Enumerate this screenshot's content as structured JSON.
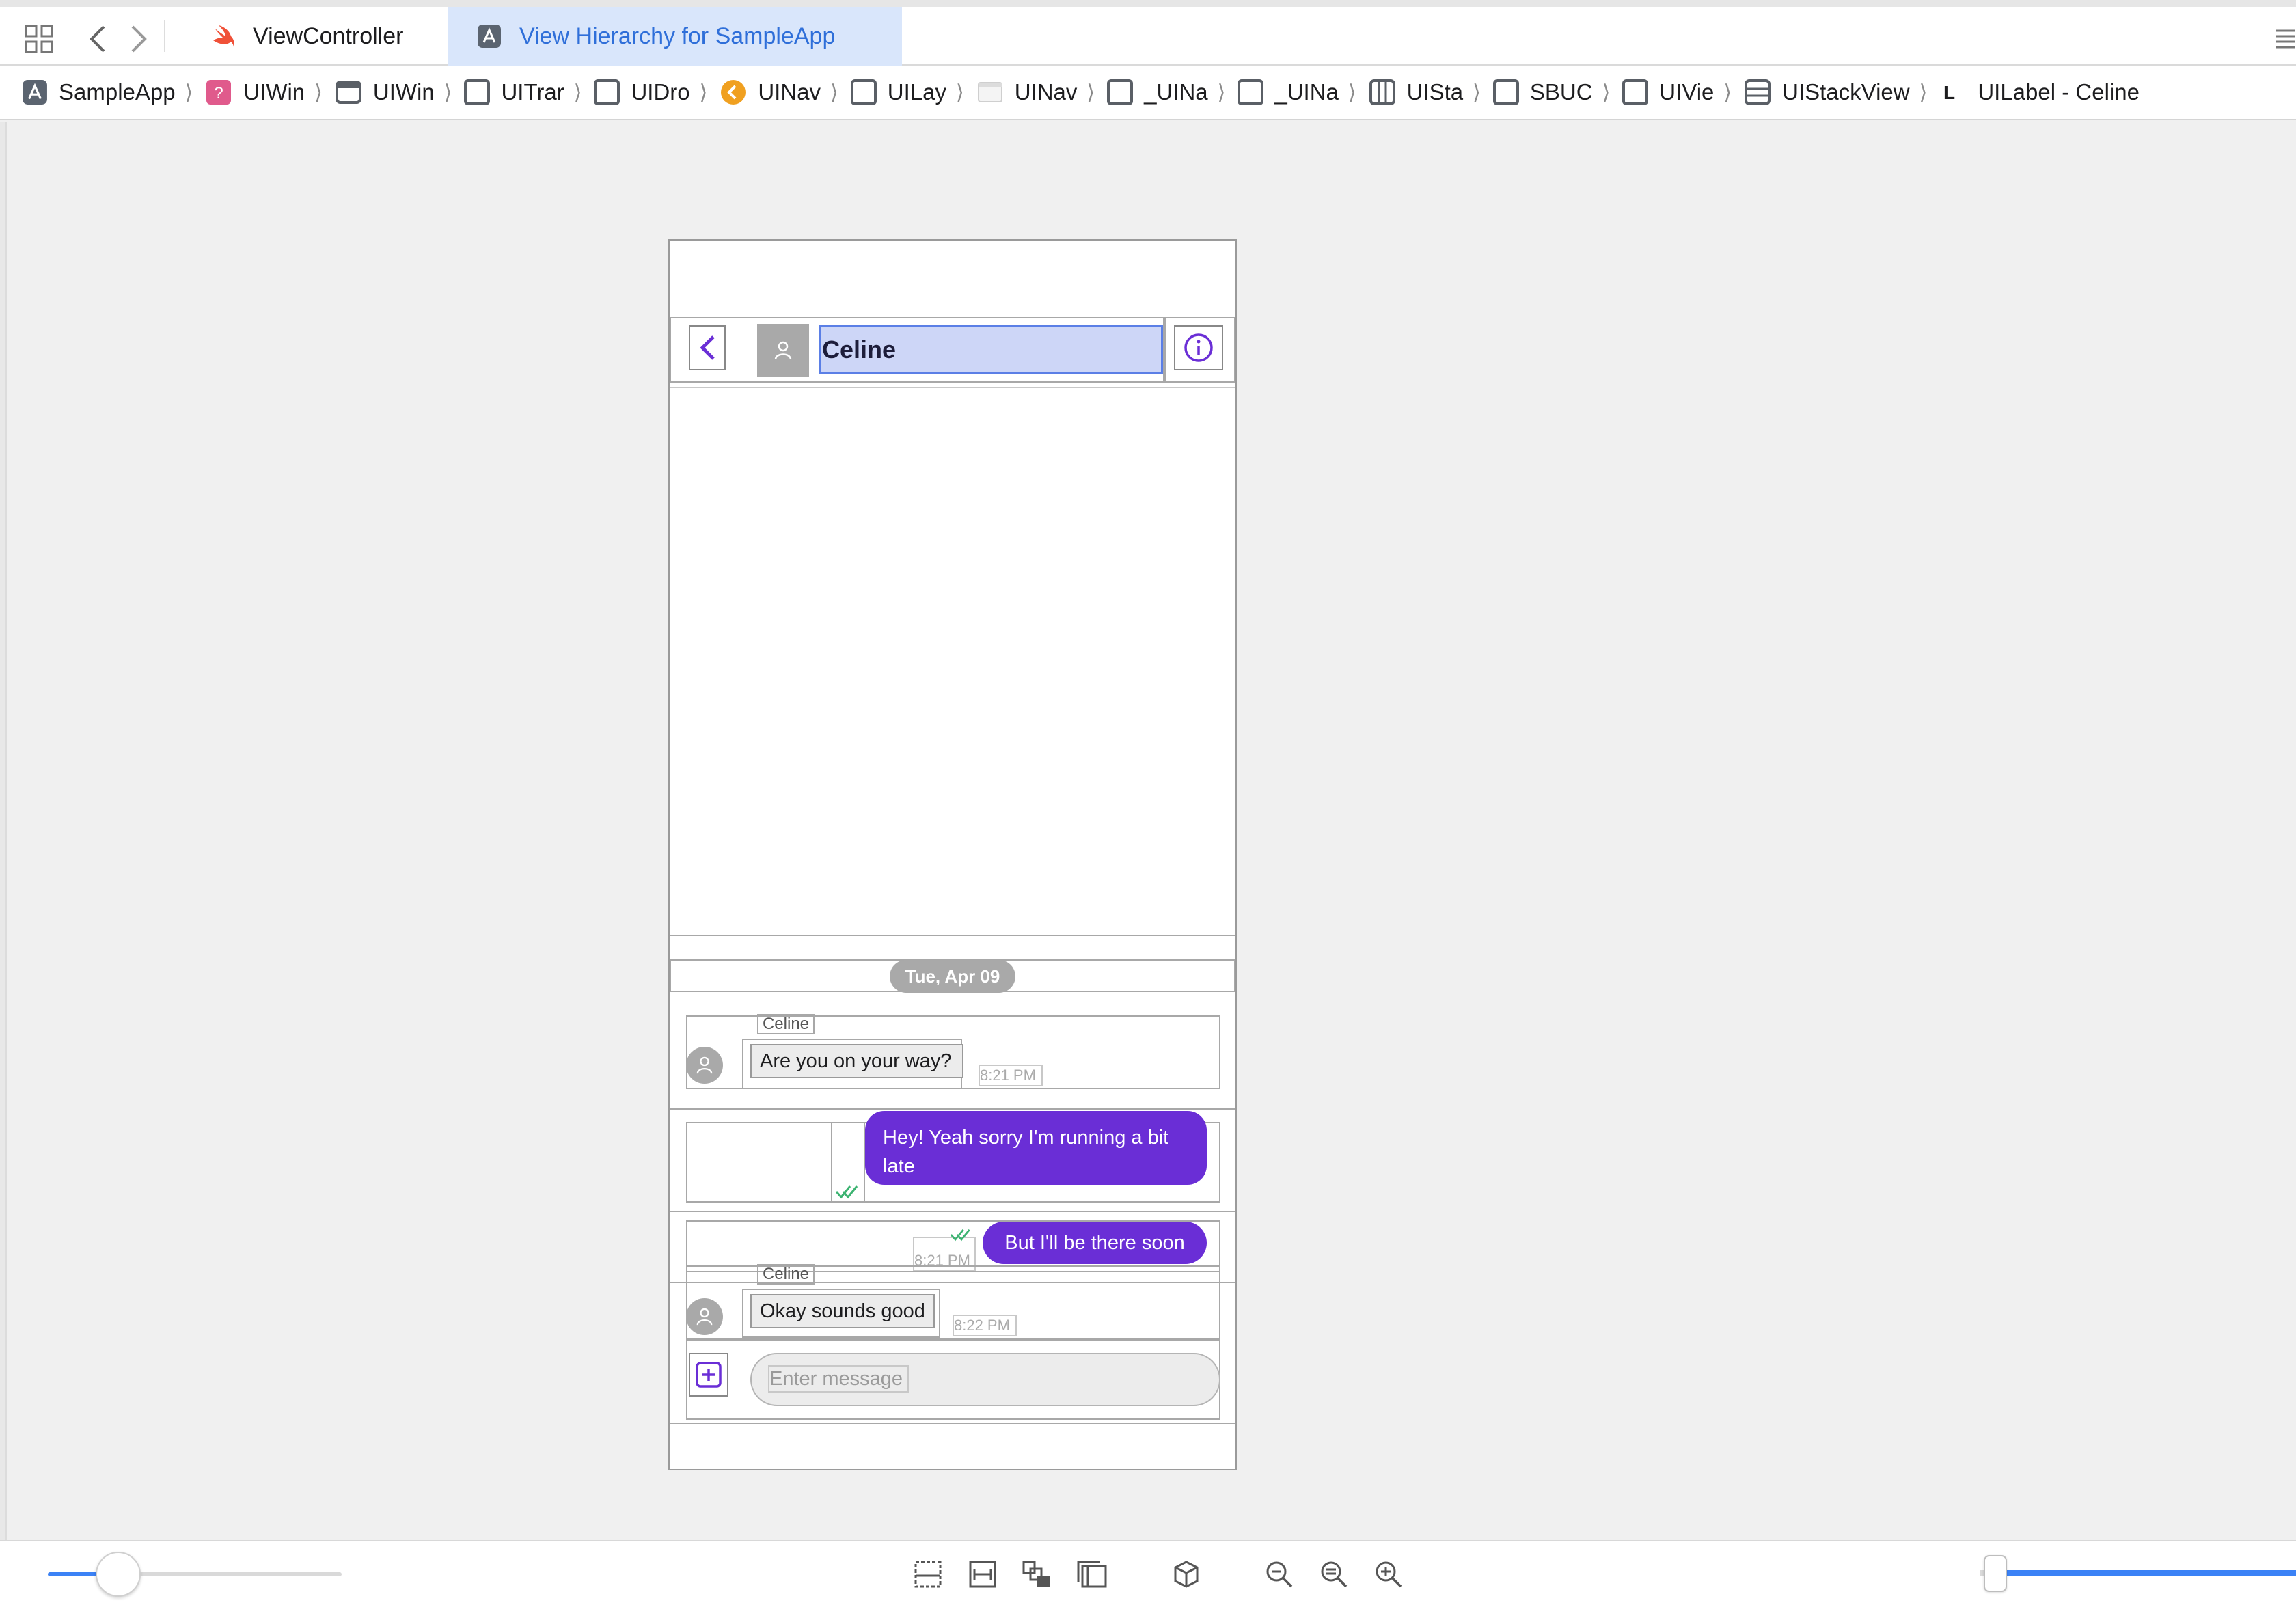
{
  "tabs": [
    {
      "label": "ViewController"
    },
    {
      "label": "View Hierarchy for SampleApp"
    }
  ],
  "breadcrumb": [
    {
      "label": "SampleApp"
    },
    {
      "label": "UIWin"
    },
    {
      "label": "UIWin"
    },
    {
      "label": "UITrar"
    },
    {
      "label": "UIDro"
    },
    {
      "label": "UINav"
    },
    {
      "label": "UILay"
    },
    {
      "label": "UINav"
    },
    {
      "label": "_UINa"
    },
    {
      "label": "_UINa"
    },
    {
      "label": "UISta"
    },
    {
      "label": "SBUC"
    },
    {
      "label": "UIVie"
    },
    {
      "label": "UIStackView"
    },
    {
      "label": "UILabel - Celine"
    }
  ],
  "phone": {
    "nav_title": "Celine",
    "date_label": "Tue, Apr 09",
    "messages": [
      {
        "sender": "Celine",
        "text": "Are you on your way?",
        "time": "8:21 PM"
      },
      {
        "text": "Hey! Yeah sorry I'm running a bit late"
      },
      {
        "text": "But I'll be there soon",
        "time": "8:21 PM"
      },
      {
        "sender": "Celine",
        "text": "Okay sounds good",
        "time": "8:22 PM"
      }
    ],
    "input_placeholder": "Enter message"
  },
  "colors": {
    "accent": "#6a2ed6",
    "selection": "#cdd6f7",
    "tab_active_bg": "#d9e6fb",
    "tab_active_text": "#2f6fd9",
    "slider": "#3b82f6"
  },
  "slider_left_value": 0.24,
  "slider_right_value": 0.01
}
